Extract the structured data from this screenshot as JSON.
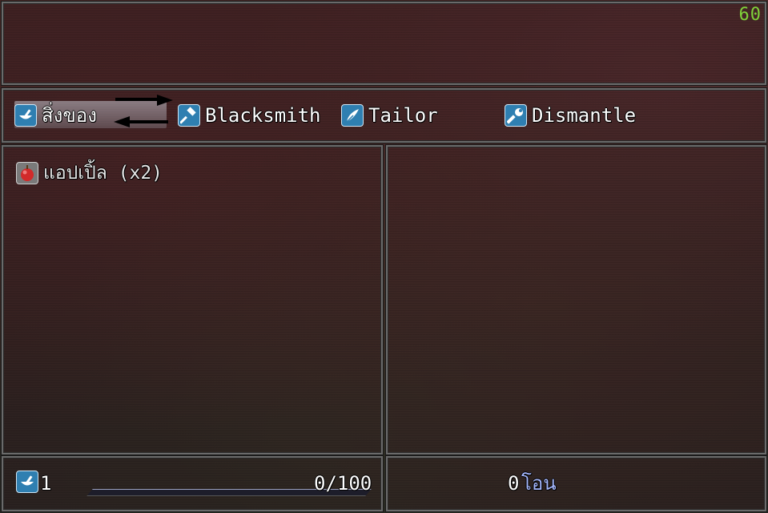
{
  "fps": "60",
  "commands": [
    {
      "label": "สิ่งของ",
      "icon": "mortar-pestle-icon",
      "selected": true
    },
    {
      "label": "Blacksmith",
      "icon": "hammer-icon",
      "selected": false
    },
    {
      "label": "Tailor",
      "icon": "feather-quill-icon",
      "selected": false
    },
    {
      "label": "Dismantle",
      "icon": "wrench-icon",
      "selected": false
    }
  ],
  "items": [
    {
      "label": "แอปเปิ้ล (x2)",
      "icon": "apple-icon"
    }
  ],
  "status": {
    "level": "1",
    "icon": "mortar-pestle-icon",
    "exp_text": "0/100",
    "exp_fraction": 0
  },
  "gold": {
    "amount": "0",
    "unit": "โอน"
  },
  "colors": {
    "fps": "#7fd13a",
    "icon_bg": "#2f7fb1",
    "currency_unit": "#a6b8ff"
  }
}
